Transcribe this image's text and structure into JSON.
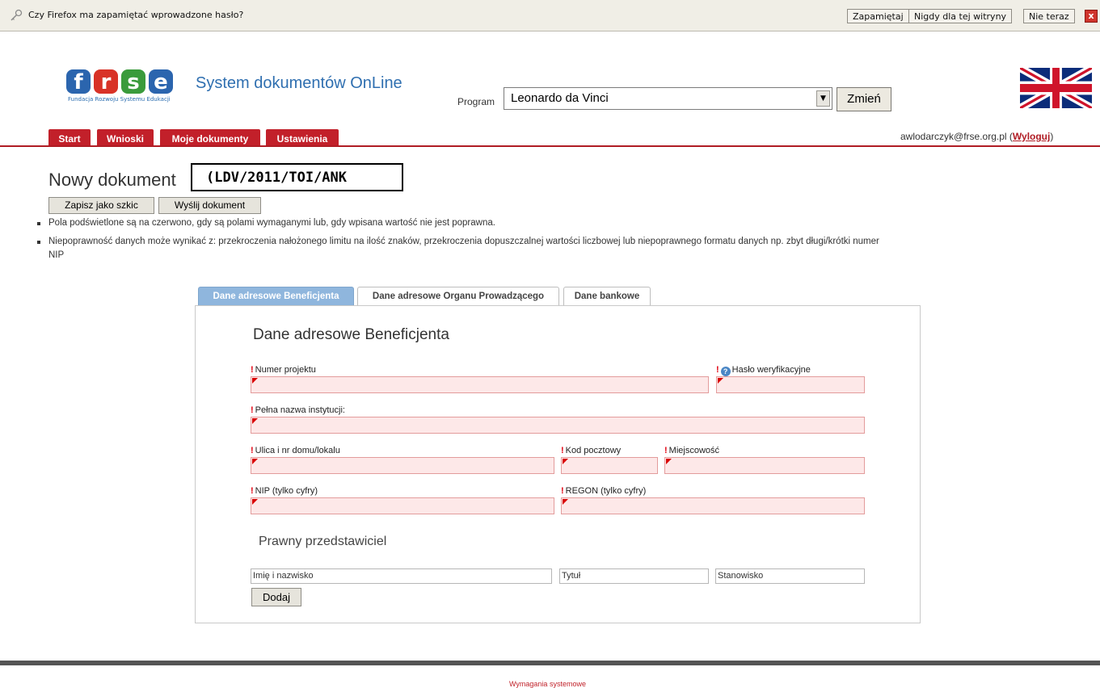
{
  "notification": {
    "message": "Czy Firefox ma zapamiętać wprowadzone hasło?",
    "remember": "Zapamiętaj",
    "never": "Nigdy dla tej witryny",
    "not_now": "Nie teraz",
    "close": "x"
  },
  "header": {
    "logo_sub": "Fundacja Rozwoju Systemu Edukacji",
    "title": "System dokumentów OnLine",
    "program_label": "Program",
    "program_value": "Leonardo da Vinci",
    "change_button": "Zmień"
  },
  "nav": {
    "tabs": [
      "Start",
      "Wnioski",
      "Moje dokumenty",
      "Ustawienia"
    ],
    "user_email": "awlodarczyk@frse.org.pl",
    "logout": "Wyloguj"
  },
  "document": {
    "title": "Nowy dokument",
    "reference": "(LDV/2011/TOI/ANK",
    "save_draft": "Zapisz jako szkic",
    "send": "Wyślij dokument",
    "notes": [
      "Pola podświetlone są na czerwono, gdy są polami wymaganymi lub, gdy wpisana wartość nie jest poprawna.",
      "Niepoprawność danych może wynikać z: przekroczenia nałożonego limitu na ilość znaków, przekroczenia dopuszczalnej wartości liczbowej lub niepoprawnego formatu danych np. zbyt długi/krótki numer",
      "NIP"
    ]
  },
  "form": {
    "tabs": [
      "Dane adresowe Beneficjenta",
      "Dane adresowe Organu Prowadzącego",
      "Dane bankowe"
    ],
    "section_title": "Dane adresowe Beneficjenta",
    "fields": {
      "project_number": "Numer projektu",
      "password": "Hasło weryfikacyjne",
      "institution": "Pełna nazwa instytucji:",
      "street": "Ulica i nr domu/lokalu",
      "postal": "Kod pocztowy",
      "city": "Miejscowość",
      "nip": "NIP (tylko cyfry)",
      "regon": "REGON (tylko cyfry)"
    },
    "legal_rep": {
      "title": "Prawny przedstawiciel",
      "name_placeholder": "Imię i nazwisko",
      "title_placeholder": "Tytuł",
      "position_placeholder": "Stanowisko",
      "add_button": "Dodaj"
    }
  },
  "footer": {
    "link": "Wymagania systemowe"
  }
}
